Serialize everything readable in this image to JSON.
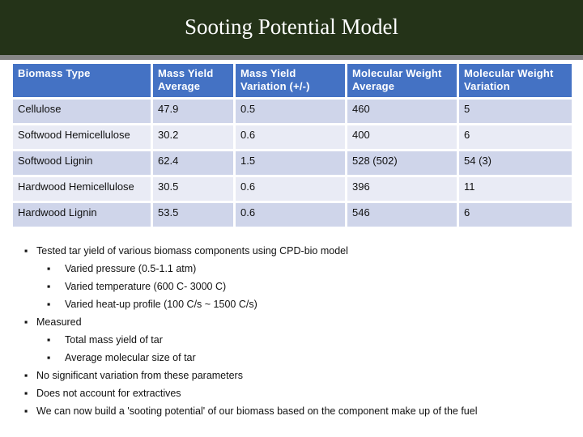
{
  "slide": {
    "title": "Sooting Potential Model",
    "colors": {
      "title_bar": "#243318",
      "header_row": "#4472c4",
      "row_odd": "#cfd5ea",
      "row_even": "#e9ebf5"
    }
  },
  "table": {
    "headers": [
      [
        "Biomass Type",
        ""
      ],
      [
        "Mass Yield",
        "Average"
      ],
      [
        "Mass Yield",
        "Variation (+/-)"
      ],
      [
        "Molecular Weight",
        "Average"
      ],
      [
        "Molecular Weight",
        "Variation"
      ]
    ],
    "rows": [
      [
        "Cellulose",
        "47.9",
        "0.5",
        "460",
        "5"
      ],
      [
        "Softwood Hemicellulose",
        "30.2",
        "0.6",
        "400",
        "6"
      ],
      [
        "Softwood Lignin",
        "62.4",
        "1.5",
        "528 (502)",
        "54 (3)"
      ],
      [
        "Hardwood Hemicellulose",
        "30.5",
        "0.6",
        "396",
        "11"
      ],
      [
        "Hardwood Lignin",
        "53.5",
        "0.6",
        "546",
        "6"
      ]
    ]
  },
  "bullets": [
    {
      "level": 1,
      "marker": "▪",
      "text": "Tested tar yield of various biomass components using CPD-bio model"
    },
    {
      "level": 2,
      "marker": "▪",
      "text": "Varied pressure (0.5-1.1 atm)"
    },
    {
      "level": 2,
      "marker": "▪",
      "text": "Varied temperature (600 C- 3000 C)"
    },
    {
      "level": 2,
      "marker": "▪",
      "text": "Varied heat-up profile (100 C/s ~ 1500 C/s)"
    },
    {
      "level": 1,
      "marker": "▪",
      "text": "Measured"
    },
    {
      "level": 2,
      "marker": "▪",
      "text": "Total mass yield of tar"
    },
    {
      "level": 2,
      "marker": "▪",
      "text": "Average molecular size of tar"
    },
    {
      "level": 1,
      "marker": "▪",
      "text": "No significant variation from these parameters"
    },
    {
      "level": 1,
      "marker": "▪",
      "text": "Does not account for extractives"
    },
    {
      "level": 1,
      "marker": "▪",
      "text": "We can now build a 'sooting potential' of our biomass based on the component make up of the fuel"
    }
  ]
}
